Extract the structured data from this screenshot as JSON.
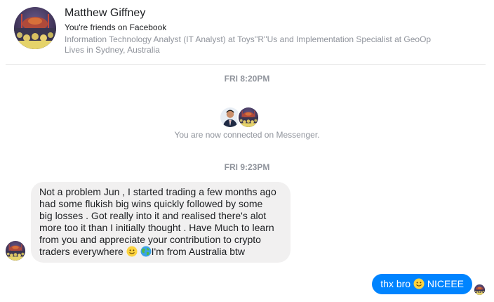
{
  "header": {
    "name": "Matthew Giffney",
    "friend_status": "You're friends on Facebook",
    "work": "Information Technology Analyst (IT Analyst) at Toys''R''Us and Implementation Specialist at GeoOp",
    "lives": "Lives in Sydney, Australia"
  },
  "thread": {
    "timestamp_1": "FRI 8:20PM",
    "connected_text": "You are now connected on Messenger.",
    "timestamp_2": "FRI 9:23PM",
    "incoming": {
      "line1": "Not a problem Jun , I started trading a few months ago",
      "line2": "had some flukish big wins quickly followed by some",
      "line3": "big losses . Got really into it and realised there's alot",
      "line4": "more too it than I initially thought . Have Much to learn",
      "line5": "from you and appreciate your contribution to crypto",
      "line6_a": "traders everywhere ",
      "line6_b": "I'm from Australia btw"
    },
    "outgoing": {
      "text_a": "thx bro ",
      "text_b": " NICEEE"
    }
  },
  "colors": {
    "outgoing_bubble": "#0084ff",
    "incoming_bubble": "#f1f0f0",
    "meta_text": "#90949c"
  },
  "icons": [
    "profile-avatar",
    "smiley-emoji-icon",
    "globe-emoji-icon"
  ]
}
